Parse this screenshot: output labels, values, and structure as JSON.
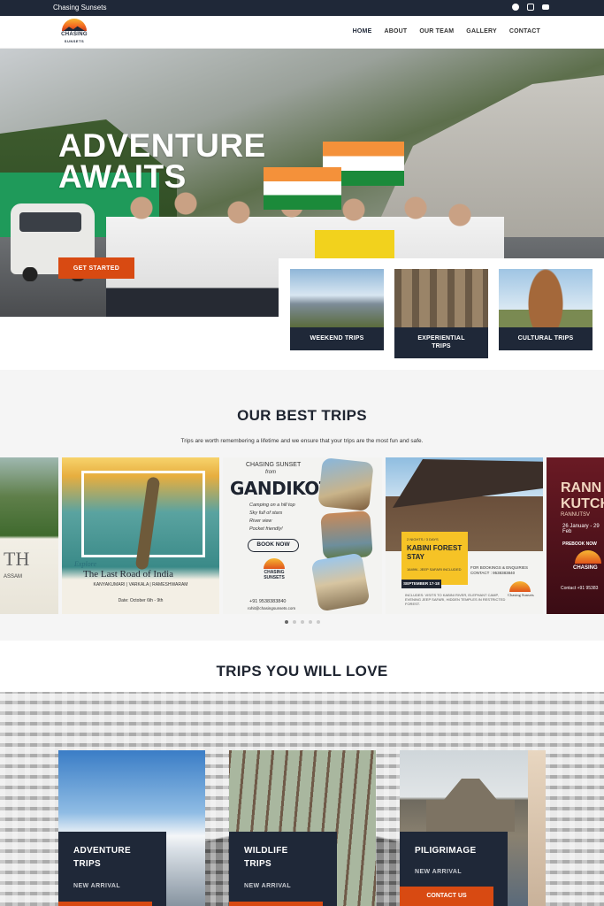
{
  "topbar": {
    "brand": "Chasing Sunsets",
    "social_icons": [
      "facebook-icon",
      "instagram-icon",
      "youtube-icon"
    ]
  },
  "nav": {
    "logo_line1": "CHASING",
    "logo_line2": "SUNSETS",
    "items": [
      "HOME",
      "ABOUT",
      "OUR TEAM",
      "GALLERY",
      "CONTACT"
    ],
    "active": "HOME"
  },
  "hero": {
    "title_line1": "ADVENTURE",
    "title_line2": "AWAITS",
    "cta": "GET STARTED"
  },
  "categories": [
    {
      "label": "WEEKEND TRIPS"
    },
    {
      "label_line1": "EXPERIENTIAL",
      "label_line2": "TRIPS"
    },
    {
      "label": "CULTURAL TRIPS"
    }
  ],
  "best_trips": {
    "title": "OUR BEST TRIPS",
    "subtitle": "Trips are worth remembering a lifetime and we ensure that your trips are the most fun and safe.",
    "slides": {
      "assam": {
        "big": "TH",
        "cap": "ASSAM"
      },
      "varkala": {
        "explore": "Explore",
        "title": "The Last Road of India",
        "places": "KANYAKUMARI | VARKALA | RAMESHWARAM",
        "date": "Date: October 6th - 9th"
      },
      "gandikota": {
        "line1": "CHASING SUNSET",
        "line2": "from",
        "title": "GANDIKOTA",
        "features": [
          "Camping on a hill top",
          "Sky full of stars",
          "River view",
          "Pocket friendly!"
        ],
        "book": "BOOK NOW",
        "logo_text": "CHASING SUNSETS",
        "phone": "+91 9538383840",
        "email": "rohit@chasingsunsets.com"
      },
      "kabini": {
        "kicker": "2 NIGHTS / 3 DAYS",
        "title_line1": "KABINI FOREST",
        "title_line2": "STAY",
        "price": "16499/- JEEP SAFARI INCLUDED",
        "date": "SEPTEMBER 17-18",
        "cta": "FOR BOOKINGS & ENQUIRIES CONTACT : 9538383840",
        "desc": "INCLUDES: VISITS TO KABINI RIVER, ELEPHANT CAMP, EVENING JEEP SAFARI, HIDDEN TEMPLES IN RESTRICTED FOREST.",
        "logo_text": "Chasing Sunsets"
      },
      "rann": {
        "title_line1": "RANN",
        "title_line2": "KUTCH",
        "sub": "RANNUTSV",
        "dates": "26 January - 29 Feb",
        "prebook": "PREBOOK NOW",
        "logo_text": "CHASING",
        "contact": "Contact +91 95383"
      }
    },
    "dots": 5,
    "active_dot": 0
  },
  "love": {
    "title": "TRIPS YOU WILL LOVE",
    "cards": [
      {
        "title_line1": "ADVENTURE",
        "title_line2": "TRIPS",
        "badge": "NEW ARRIVAL"
      },
      {
        "title_line1": "WILDLIFE",
        "title_line2": "TRIPS",
        "badge": "NEW ARRIVAL"
      },
      {
        "title_line1": "PILIGRIMAGE",
        "badge": "NEW ARRIVAL",
        "button": "CONTACT US"
      }
    ]
  }
}
